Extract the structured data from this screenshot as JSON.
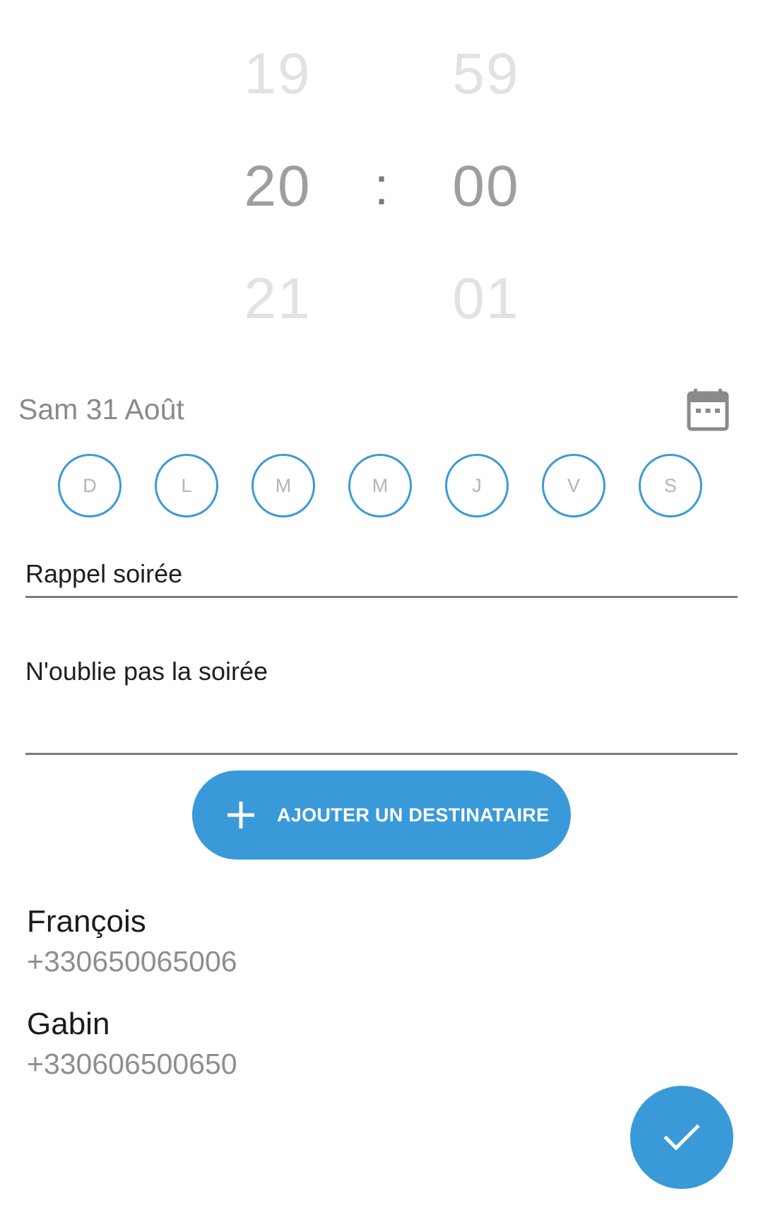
{
  "time_picker": {
    "hours": {
      "previous": "19",
      "selected": "20",
      "next": "21"
    },
    "minutes": {
      "previous": "59",
      "selected": "00",
      "next": "01"
    },
    "separator": ":"
  },
  "date": {
    "label": "Sam 31 Août",
    "icon": "calendar-icon"
  },
  "days": [
    "D",
    "L",
    "M",
    "M",
    "J",
    "V",
    "S"
  ],
  "form": {
    "title_value": "Rappel soirée",
    "message_value": "N'oublie pas la soirée"
  },
  "add_recipient": {
    "label": "AJOUTER UN DESTINATAIRE",
    "icon": "plus-icon"
  },
  "recipients": [
    {
      "name": "François",
      "phone": "+330650065006"
    },
    {
      "name": "Gabin",
      "phone": "+330606500650"
    }
  ],
  "fab": {
    "icon": "check-icon"
  },
  "colors": {
    "accent": "#3a9ad9",
    "picker_selected": "#9e9e9e",
    "picker_dim": "#e2e2e2",
    "secondary_text": "#8e8e8e"
  }
}
